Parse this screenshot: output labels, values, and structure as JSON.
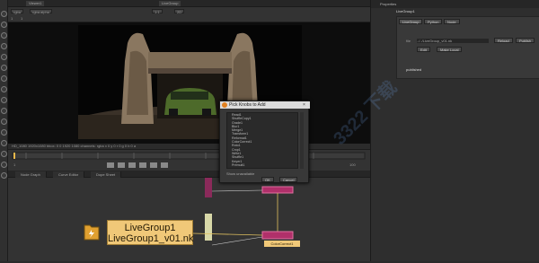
{
  "colors": {
    "node_pink": "#b0306a",
    "livegroup_fill": "#f0c878",
    "edge_yellow": "#e0c060"
  },
  "topbar": {
    "tab": "Viewer1",
    "tab2": "LiveGroup"
  },
  "viewer_controls": {
    "channels": "rgba",
    "layer": "rgba.alpha",
    "zoom": "1:1",
    "mode": "2D",
    "proxy": "1",
    "gain": "1"
  },
  "info_bar": {
    "text": "HD_1080 1920x1080  bbox: 0 0 1920 1080 channels: rgba  x 0 y 0 r 0 g 0 b 0 a"
  },
  "timeline": {
    "frame": "1",
    "end": "100"
  },
  "node_tabs": [
    "Node Graph",
    "Curve Editor",
    "Dope Sheet"
  ],
  "properties": {
    "title": "Properties",
    "node_name": "LiveGroup1",
    "tabs": [
      "LiveGroup",
      "Python",
      "Node"
    ],
    "file_label": "file",
    "file_value": "../../LiveGroup_v01.nk",
    "buttons": {
      "reload": "Reload",
      "publish": "Publish",
      "edit": "Edit",
      "make_local": "Make Local"
    },
    "status": "published"
  },
  "dialog": {
    "title": "Pick Knobs to Add",
    "items": [
      "Read1",
      "ShuffleCopy1",
      "Grade1",
      "Blur1",
      "Merge1",
      "Transform1",
      "Reformat1",
      "ColorCorrect1",
      "Roto1",
      "Crop1",
      "Write1",
      "Shuffle1",
      "Keyer1",
      "Premult1",
      "Dot1"
    ],
    "footer": "Show unavailable",
    "ok": "OK",
    "cancel": "Cancel"
  },
  "node_graph": {
    "livegroup_line1": "LiveGroup1",
    "livegroup_line2": "LiveGroup1_v01.nk",
    "color_correct": "ColorCorrect1"
  },
  "watermark": "3322 下载"
}
